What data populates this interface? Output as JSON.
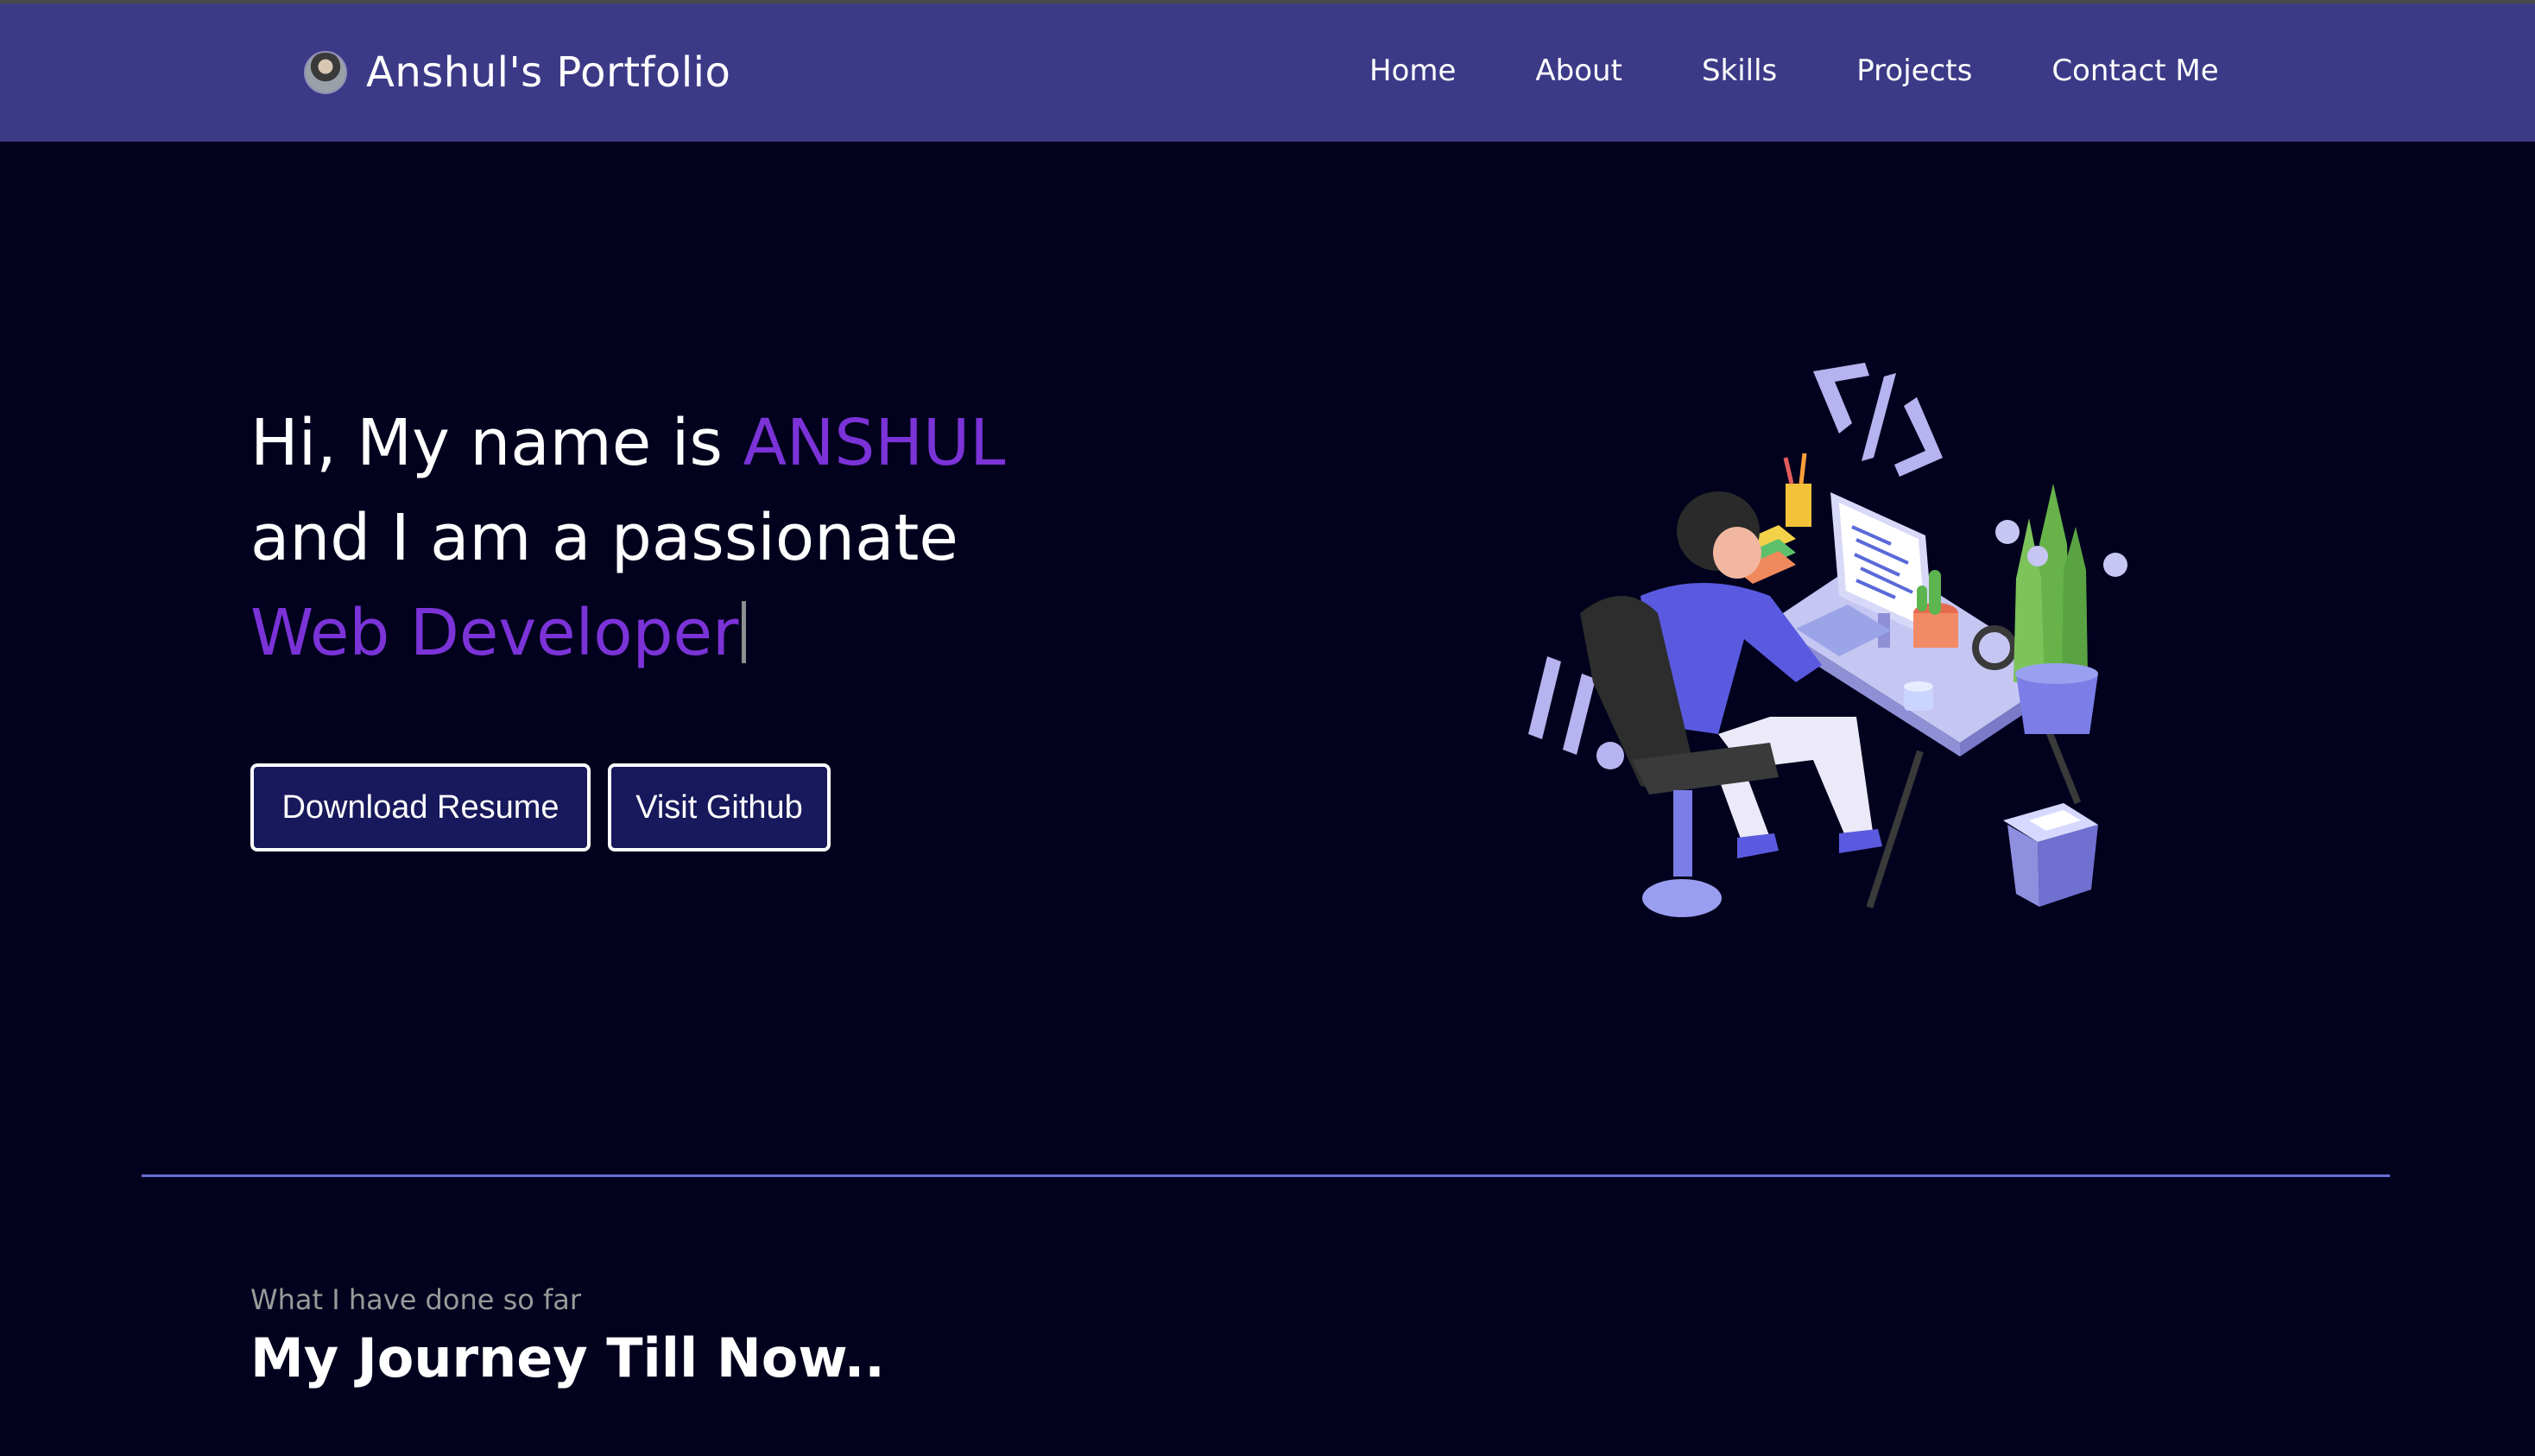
{
  "navbar": {
    "brand": "Anshul's Portfolio",
    "links": [
      "Home",
      "About",
      "Skills",
      "Projects",
      "Contact Me"
    ]
  },
  "hero": {
    "line1_prefix": "Hi, My name is ",
    "name": "ANSHUL",
    "line2": "and I am a passionate",
    "role": "Web Developer",
    "buttons": {
      "resume": "Download Resume",
      "github": "Visit Github"
    }
  },
  "journey": {
    "subtitle": "What I have done so far",
    "title": "My Journey Till Now.."
  },
  "colors": {
    "background": "#02021e",
    "navbar": "#3c3a87",
    "accent": "#7b33d8",
    "button_bg": "#18185c",
    "divider": "#6a6cd6"
  },
  "icons": {
    "avatar": "avatar-photo",
    "illustration": "developer-at-desk-illustration"
  }
}
